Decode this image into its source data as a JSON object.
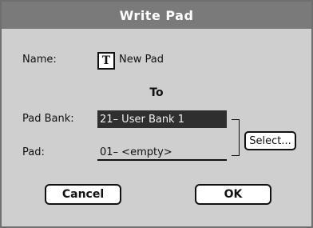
{
  "window": {
    "title": "Write Pad"
  },
  "name": {
    "label": "Name:",
    "text_button_glyph": "T",
    "value": "New Pad"
  },
  "to_heading": "To",
  "pad_bank": {
    "label": "Pad Bank:",
    "value": "21– User Bank 1"
  },
  "pad": {
    "label": "Pad:",
    "value": "01– <empty>"
  },
  "select_button": "Select...",
  "buttons": {
    "cancel": "Cancel",
    "ok": "OK"
  }
}
